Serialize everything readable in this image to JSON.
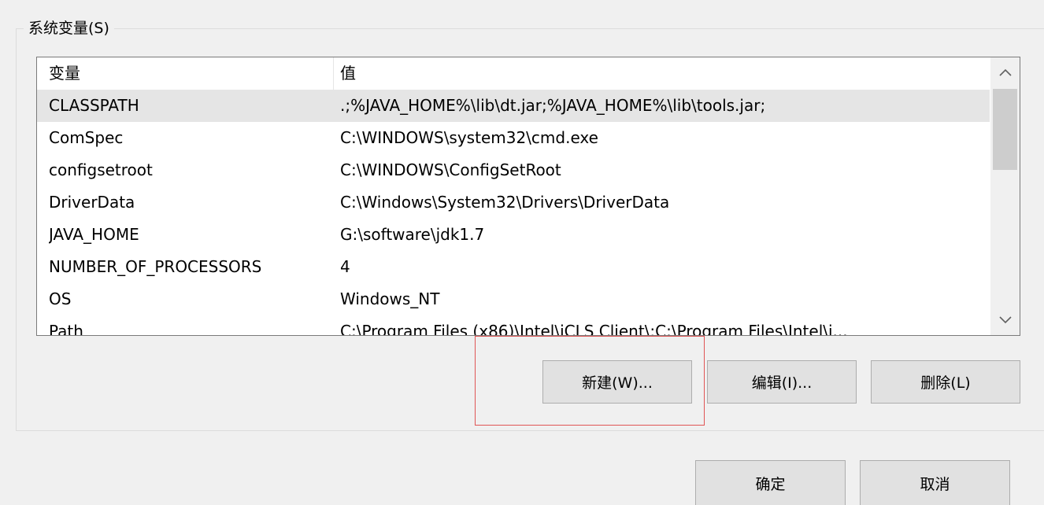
{
  "group": {
    "title": "系统变量(S)"
  },
  "listview": {
    "columns": [
      "变量",
      "值"
    ],
    "rows": [
      {
        "name": "CLASSPATH",
        "value": ".;%JAVA_HOME%\\lib\\dt.jar;%JAVA_HOME%\\lib\\tools.jar;",
        "selected": true
      },
      {
        "name": "ComSpec",
        "value": "C:\\WINDOWS\\system32\\cmd.exe"
      },
      {
        "name": "configsetroot",
        "value": "C:\\WINDOWS\\ConfigSetRoot"
      },
      {
        "name": "DriverData",
        "value": "C:\\Windows\\System32\\Drivers\\DriverData"
      },
      {
        "name": "JAVA_HOME",
        "value": "G:\\software\\jdk1.7"
      },
      {
        "name": "NUMBER_OF_PROCESSORS",
        "value": "4"
      },
      {
        "name": "OS",
        "value": "Windows_NT"
      },
      {
        "name": "Path",
        "value": "C:\\Program Files (x86)\\Intel\\iCLS Client\\;C:\\Program Files\\Intel\\i..."
      }
    ],
    "scroll_up_icon": "chevron-up-icon",
    "scroll_down_icon": "chevron-down-icon"
  },
  "buttons": {
    "new_label": "新建(W)...",
    "edit_label": "编辑(I)...",
    "delete_label": "删除(L)",
    "ok_label": "确定",
    "cancel_label": "取消"
  },
  "colors": {
    "highlight": "#e05555",
    "selected_row": "#e5e5e5",
    "dialog_bg": "#f0f0f0"
  }
}
